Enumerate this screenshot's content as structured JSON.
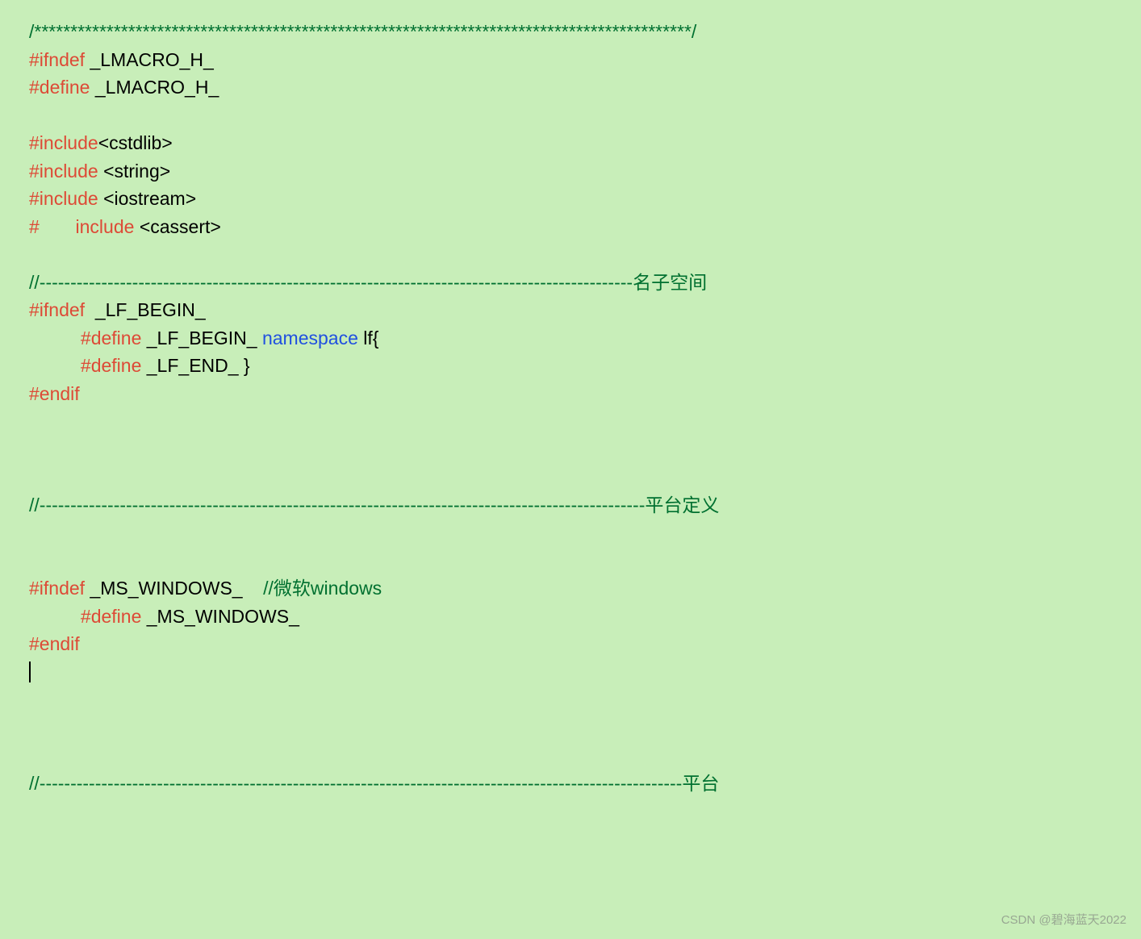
{
  "lines": {
    "l1": "/*******************************************************************************************/",
    "l2_ifndef": "#ifndef",
    "l2_rest": " _LMACRO_H_",
    "l3_define": "#define",
    "l3_rest": " _LMACRO_H_",
    "l5_include": "#include",
    "l5_rest": "<cstdlib>",
    "l6_include": "#include ",
    "l6_rest": "<string>",
    "l7_include": "#include ",
    "l7_rest": "<iostream>",
    "l8_hash": "#",
    "l8_include": "       include ",
    "l8_rest": "<cassert>",
    "l10_dash": "//------------------------------------------------------------------------------------------------",
    "l10_label": "名子空间",
    "l11_ifndef": "#ifndef  ",
    "l11_rest": "_LF_BEGIN_",
    "l12_indent": "          ",
    "l12_define": "#define ",
    "l12_name": "_LF_BEGIN_",
    "l12_namespace": " namespace ",
    "l12_rest": "lf{",
    "l13_indent": "          ",
    "l13_define": "#define ",
    "l13_rest": "_LF_END_ }",
    "l14_endif": "#endif",
    "l18_dash": "//--------------------------------------------------------------------------------------------------",
    "l18_label": "平台定义",
    "l21_ifndef": "#ifndef ",
    "l21_name": "_MS_WINDOWS_    ",
    "l21_comment": "//微软windows",
    "l22_indent": "          ",
    "l22_define": "#define ",
    "l22_rest": "_MS_WINDOWS_",
    "l23_endif": "#endif",
    "l28_dash": "//--------------------------------------------------------------------------------------------------------",
    "l28_label": "平台",
    "watermark": "CSDN @碧海蓝天2022"
  }
}
